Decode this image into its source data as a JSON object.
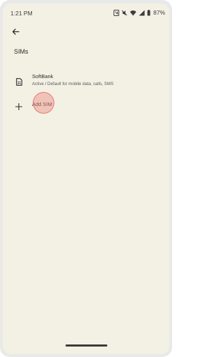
{
  "status_bar": {
    "time": "1:21 PM",
    "battery": "87%",
    "icons": [
      "nfc-icon",
      "mute-icon",
      "wifi-icon",
      "signal-icon",
      "battery-icon"
    ]
  },
  "header": {
    "back_icon": "arrow-back-icon",
    "title": "SIMs"
  },
  "sims": [
    {
      "icon": "sim-card-icon",
      "name": "SoftBank",
      "status": "Active / Default for mobile data, calls, SMS"
    }
  ],
  "add_sim": {
    "icon": "plus-icon",
    "label": "Add SIM"
  },
  "colors": {
    "background": "#f3f0e4",
    "text": "#2b2b2b",
    "touch": "#e06e64"
  }
}
